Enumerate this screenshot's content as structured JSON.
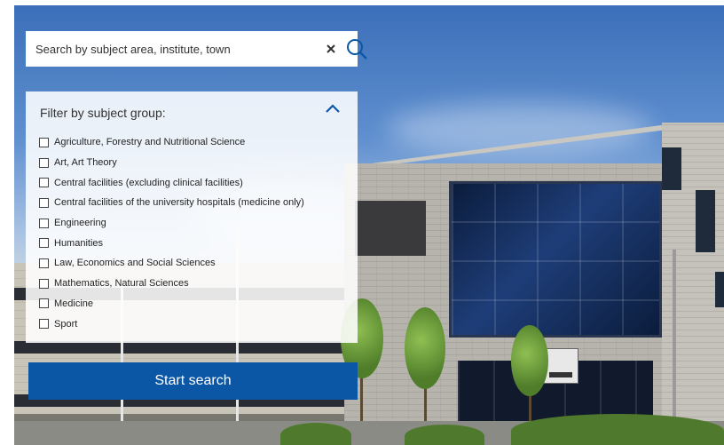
{
  "search": {
    "placeholder": "Search by subject area, institute, town",
    "value": "",
    "clear_icon": "close-icon",
    "search_icon": "search-icon"
  },
  "filter": {
    "title": "Filter by subject group:",
    "toggle_icon": "chevron-up-icon",
    "options": [
      {
        "label": "Agriculture, Forestry and Nutritional Science",
        "checked": false
      },
      {
        "label": "Art, Art Theory",
        "checked": false
      },
      {
        "label": "Central facilities (excluding clinical facilities)",
        "checked": false
      },
      {
        "label": "Central facilities of the university hospitals (medicine only)",
        "checked": false
      },
      {
        "label": "Engineering",
        "checked": false
      },
      {
        "label": "Humanities",
        "checked": false
      },
      {
        "label": "Law, Economics and Social Sciences",
        "checked": false
      },
      {
        "label": "Mathematics, Natural Sciences",
        "checked": false
      },
      {
        "label": "Medicine",
        "checked": false
      },
      {
        "label": "Sport",
        "checked": false
      }
    ]
  },
  "start_button": {
    "label": "Start search"
  },
  "colors": {
    "accent": "#0b57a6",
    "search_icon": "#0b57a6"
  }
}
